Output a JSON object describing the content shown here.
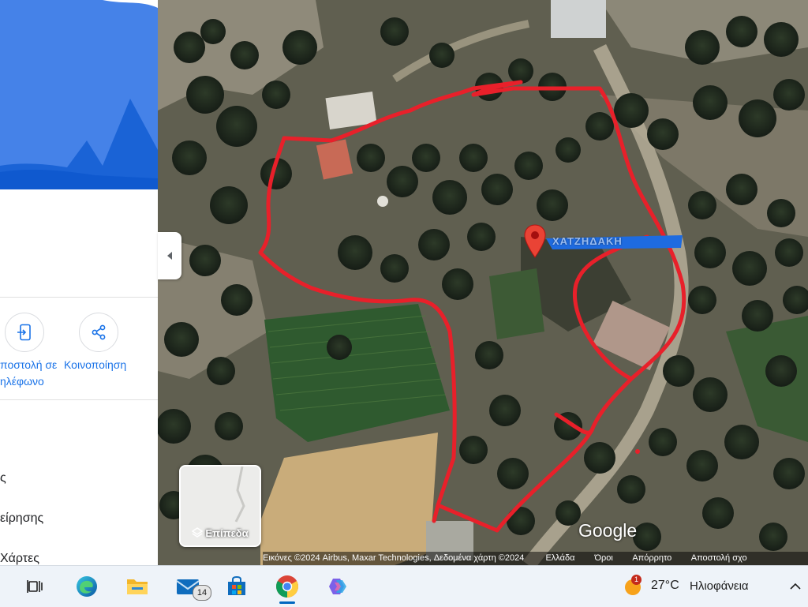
{
  "side_panel": {
    "actions": [
      {
        "label_lines": [
          "ποστολή σε",
          "ηλέφωνο"
        ],
        "icon": "send-to-phone-icon"
      },
      {
        "label_lines": [
          "Κοινοποίηση"
        ],
        "icon": "share-icon"
      }
    ],
    "list_items": [
      "ς",
      "είρησης",
      "Χάρτες"
    ]
  },
  "map": {
    "pin_label": "ΧΑΤΖΗΔΑΚΗ",
    "layers_label": "Επίπεδα",
    "google_logo": "Google",
    "attribution": {
      "imagery": "Εικόνες ©2024 Airbus, Maxar Technologies, Δεδομένα χάρτη ©2024",
      "country": "Ελλάδα",
      "terms": "Όροι",
      "privacy": "Απόρρητο",
      "send_feedback": "Αποστολή σχο"
    }
  },
  "taskbar": {
    "mail_badge": "14",
    "weather": {
      "temp": "27°C",
      "desc": "Ηλιοφάνεια",
      "alert": "1"
    },
    "colors": {
      "accent": "#0067c0",
      "taskbar_bg": "#eef3f9"
    }
  },
  "colors": {
    "boundary": "#e8202a",
    "pin": "#ea4335",
    "panel_header": "#4285f4"
  }
}
